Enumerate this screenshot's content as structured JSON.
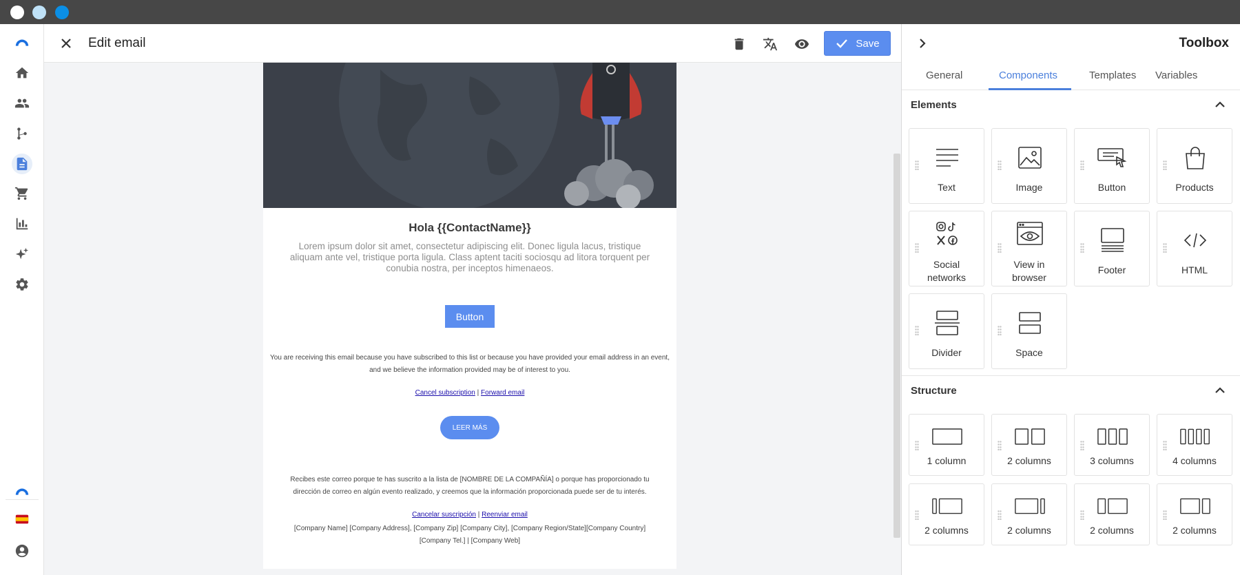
{
  "os": {
    "dots": [
      "window-close",
      "window-minimize",
      "window-maximize"
    ]
  },
  "nav": {
    "items": [
      "home-icon",
      "contacts-icon",
      "automation-flow-icon",
      "document-icon",
      "cart-icon",
      "chart-icon",
      "sparkles-icon",
      "settings-icon"
    ],
    "active": "document-icon",
    "bottom": [
      "brand-logo",
      "spain-flag-icon",
      "account-icon"
    ]
  },
  "header": {
    "title": "Edit email",
    "save_label": "Save",
    "icons": [
      "close-icon",
      "trash-icon",
      "translate-icon",
      "eye-icon"
    ]
  },
  "email": {
    "greeting": "Hola {{ContactName}}",
    "lorem": "Lorem ipsum dolor sit amet, consectetur adipiscing elit. Donec ligula lacus, tristique aliquam ante vel, tristique porta ligula. Class aptent taciti sociosqu ad litora torquent per conubia nostra, per inceptos himenaeos.",
    "button_label": "Button",
    "note_en": "You are receiving this email because you have subscribed to this list or because you have provided your email address in an event, and we believe the information provided may be of interest to you.",
    "cancel_link": "Cancel subscription",
    "forward_link": "Forward email",
    "link_separator": "|",
    "leer_label": "LEER MÁS",
    "note_es": "Recibes este correo porque te has suscrito a la lista de [NOMBRE DE LA COMPAÑÍA] o porque has proporcionado tu dirección de correo en algún evento realizado, y creemos que la información proporcionada puede ser de tu interés.",
    "cancel_link_es": "Cancelar suscripción",
    "forward_link_es": "Reenviar email",
    "address_line1": "[Company Name] [Company Address], [Company Zip] [Company City], [Company Region/State][Company Country]",
    "address_line2": "[Company Tel.] | [Company Web]"
  },
  "toolbox": {
    "title": "Toolbox",
    "tabs": [
      "General",
      "Components",
      "Templates",
      "Variables"
    ],
    "active_tab": "Components",
    "elements": {
      "title": "Elements",
      "tiles": [
        "Text",
        "Image",
        "Button",
        "Products",
        "Social networks",
        "View in browser",
        "Footer",
        "HTML",
        "Divider",
        "Space"
      ]
    },
    "structure": {
      "title": "Structure",
      "tiles": [
        "1 column",
        "2 columns",
        "3 columns",
        "4 columns",
        "2 columns",
        "2 columns",
        "2 columns",
        "2 columns"
      ]
    }
  },
  "colors": {
    "accent": "#4a7fdc",
    "save_button": "#5b8def",
    "os_bar": "#474747",
    "hero_bg": "#3b4049"
  }
}
